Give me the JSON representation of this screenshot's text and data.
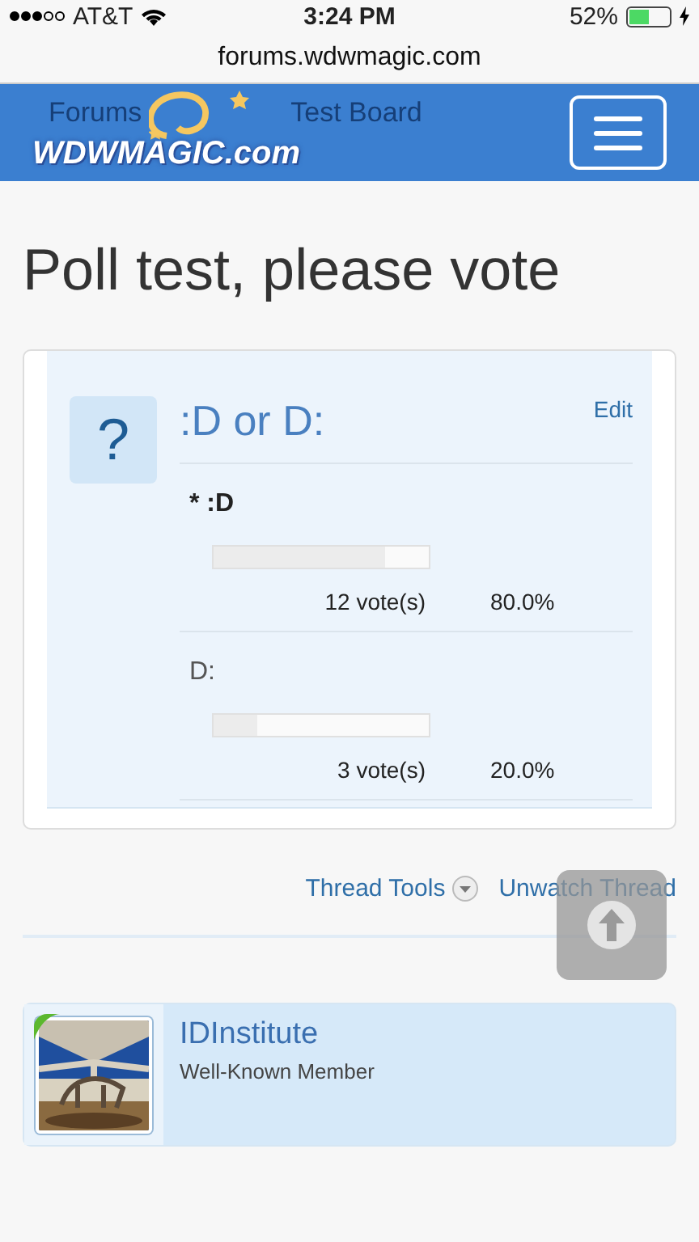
{
  "status_bar": {
    "carrier": "AT&T",
    "time": "3:24 PM",
    "battery": "52%",
    "charging": true
  },
  "address_bar": {
    "url": "forums.wdwmagic.com"
  },
  "header": {
    "logo": "WDWMAGIC.com",
    "breadcrumbs": [
      "Forums",
      "Test Board"
    ]
  },
  "page_title": "Poll test, please vote",
  "poll": {
    "icon": "?",
    "question": ":D or D:",
    "edit": "Edit",
    "options": [
      {
        "label": ":D",
        "voted": true,
        "marker": "*",
        "level": 0.8,
        "votes": "12 vote(s)",
        "percent": "80.0%"
      },
      {
        "label": "D:",
        "voted": false,
        "level": 0.2,
        "votes": "3 vote(s)",
        "percent": "20.0%"
      }
    ]
  },
  "thread_actions": [
    {
      "label": "Thread Tools",
      "kind": "dropdown"
    },
    {
      "label": "Unwatch Thread",
      "kind": "link"
    }
  ],
  "post": {
    "username": "IDInstitute",
    "user_title": "Well-Known Member",
    "online": true
  }
}
